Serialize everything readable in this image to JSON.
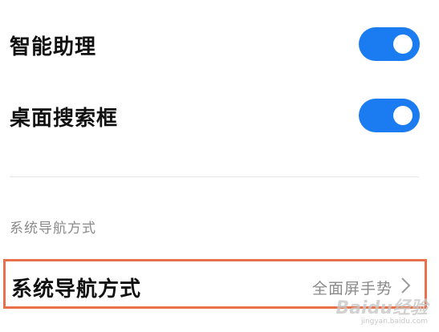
{
  "settings": {
    "smart_assistant": {
      "label": "智能助理",
      "enabled": true
    },
    "desktop_search": {
      "label": "桌面搜索框",
      "enabled": true
    }
  },
  "navigation_section": {
    "header": "系统导航方式",
    "row": {
      "label": "系统导航方式",
      "value": "全面屏手势"
    }
  },
  "watermark": {
    "brand": "Baidu经验",
    "url": "jingyan.baidu.com"
  },
  "colors": {
    "toggle_on": "#1a7cf0",
    "highlight_border": "#e8704a"
  }
}
